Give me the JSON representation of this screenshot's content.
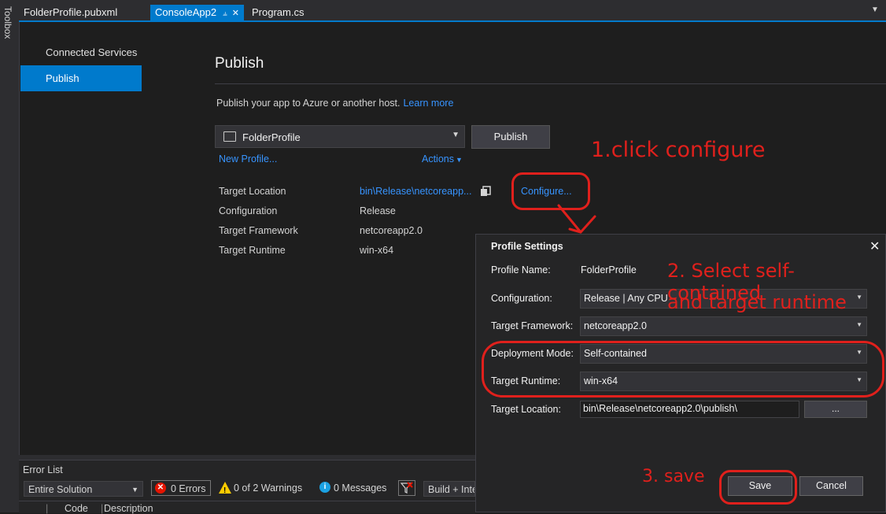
{
  "toolbox_label": "Toolbox",
  "tabs": [
    {
      "label": "FolderProfile.pubxml",
      "active": false
    },
    {
      "label": "ConsoleApp2",
      "active": true,
      "pinned": true
    },
    {
      "label": "Program.cs",
      "active": false
    }
  ],
  "nav": {
    "items": [
      {
        "label": "Connected Services",
        "selected": false
      },
      {
        "label": "Publish",
        "selected": true
      }
    ]
  },
  "publish": {
    "title": "Publish",
    "description": "Publish your app to Azure or another host.",
    "learn_more": "Learn more",
    "profile_selected": "FolderProfile",
    "publish_button": "Publish",
    "new_profile": "New Profile...",
    "actions": "Actions",
    "configure": "Configure...",
    "summary": {
      "target_location_label": "Target Location",
      "target_location_value": "bin\\Release\\netcoreapp...",
      "configuration_label": "Configuration",
      "configuration_value": "Release",
      "target_framework_label": "Target Framework",
      "target_framework_value": "netcoreapp2.0",
      "target_runtime_label": "Target Runtime",
      "target_runtime_value": "win-x64"
    }
  },
  "dialog": {
    "title": "Profile Settings",
    "close": "✕",
    "profile_name_label": "Profile Name:",
    "profile_name_value": "FolderProfile",
    "configuration_label": "Configuration:",
    "configuration_value": "Release | Any CPU",
    "framework_label": "Target Framework:",
    "framework_value": "netcoreapp2.0",
    "deployment_label": "Deployment Mode:",
    "deployment_value": "Self-contained",
    "runtime_label": "Target Runtime:",
    "runtime_value": "win-x64",
    "location_label": "Target Location:",
    "location_value": "bin\\Release\\netcoreapp2.0\\publish\\",
    "browse": "...",
    "save": "Save",
    "cancel": "Cancel"
  },
  "error_list": {
    "title": "Error List",
    "scope": "Entire Solution",
    "errors": "0 Errors",
    "warnings": "0 of 2 Warnings",
    "messages": "0 Messages",
    "build_filter": "Build + IntelliSense",
    "columns": [
      "Code",
      "Description"
    ]
  },
  "annotations": {
    "step1": "1.click configure",
    "step2_line1": "2. Select self-contained",
    "step2_line2": "and target runtime",
    "step3": "3. save",
    "color": "#e0201c"
  },
  "colors": {
    "accent": "#007acc",
    "link": "#3794ff",
    "background": "#1e1e1e"
  }
}
